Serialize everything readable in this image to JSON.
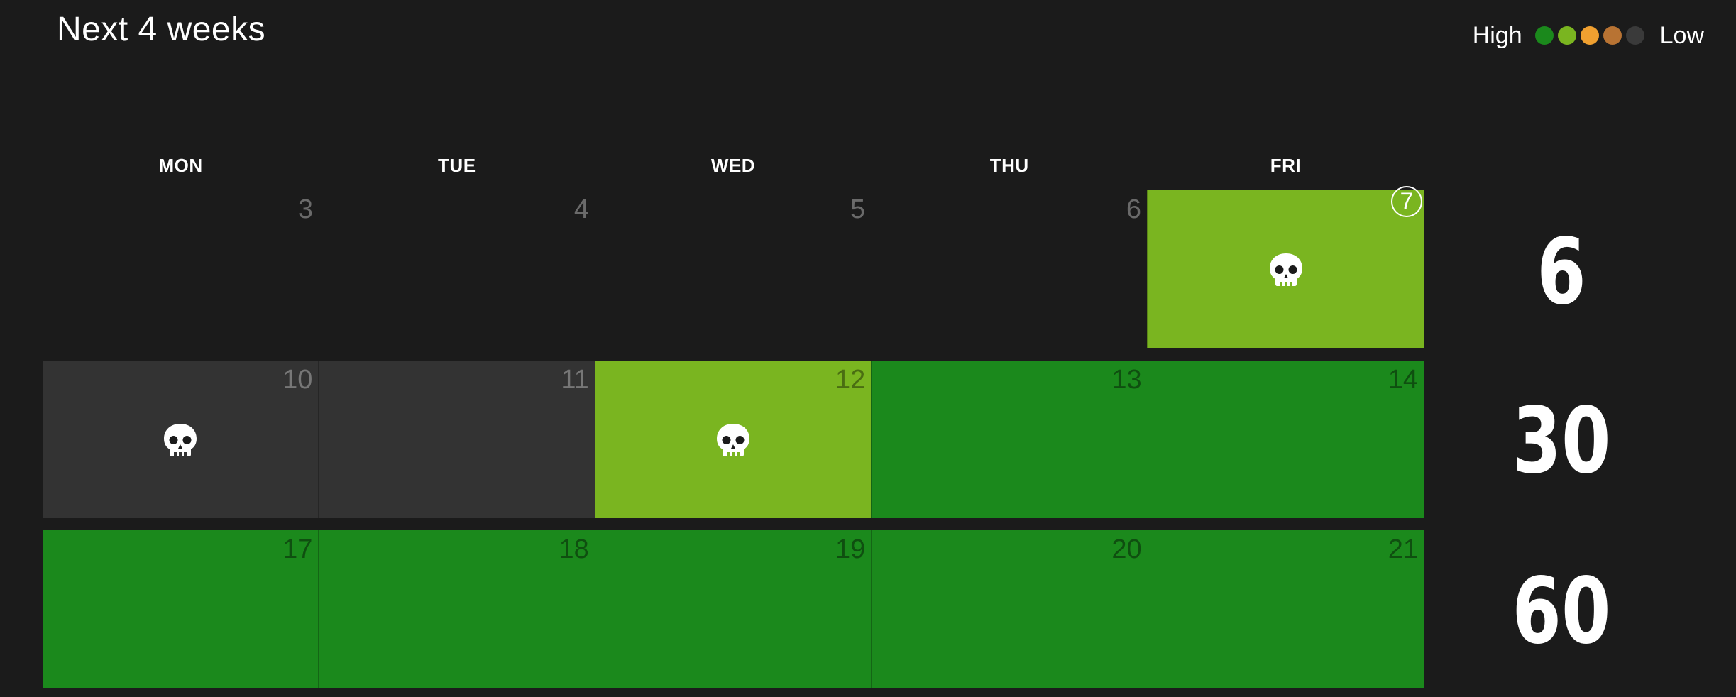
{
  "header": {
    "title": "Next 4 weeks"
  },
  "legend": {
    "high_label": "High",
    "low_label": "Low",
    "colors": [
      "#1b891c",
      "#7ab520",
      "#f0a030",
      "#b87333",
      "#3a3a3a"
    ]
  },
  "weekdays": [
    "MON",
    "TUE",
    "WED",
    "THU",
    "FRI"
  ],
  "weeks": [
    {
      "count": "6",
      "days": [
        {
          "day": "3",
          "level": "empty",
          "skull": false
        },
        {
          "day": "4",
          "level": "empty",
          "skull": false
        },
        {
          "day": "5",
          "level": "empty",
          "skull": false
        },
        {
          "day": "6",
          "level": "empty",
          "skull": false
        },
        {
          "day": "7",
          "level": "light",
          "skull": true,
          "today": true
        }
      ]
    },
    {
      "count": "30",
      "days": [
        {
          "day": "10",
          "level": "grey",
          "skull": true
        },
        {
          "day": "11",
          "level": "grey",
          "skull": false
        },
        {
          "day": "12",
          "level": "light",
          "skull": true
        },
        {
          "day": "13",
          "level": "dark",
          "skull": false
        },
        {
          "day": "14",
          "level": "dark",
          "skull": false
        }
      ]
    },
    {
      "count": "60",
      "days": [
        {
          "day": "17",
          "level": "dark",
          "skull": false
        },
        {
          "day": "18",
          "level": "dark",
          "skull": false
        },
        {
          "day": "19",
          "level": "dark",
          "skull": false
        },
        {
          "day": "20",
          "level": "dark",
          "skull": false
        },
        {
          "day": "21",
          "level": "dark",
          "skull": false
        }
      ]
    }
  ],
  "icons": {
    "event_marker": "skull-icon"
  }
}
